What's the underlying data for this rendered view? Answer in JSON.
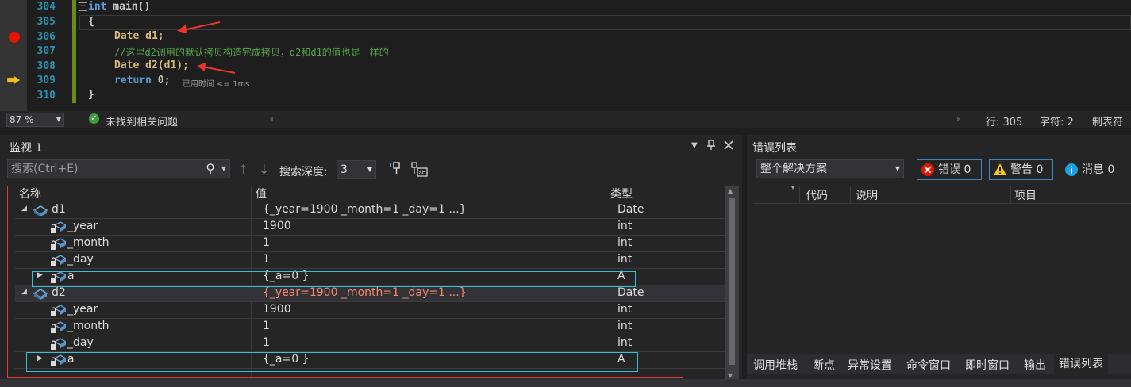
{
  "editor": {
    "lines": [
      {
        "num": "304"
      },
      {
        "num": "305"
      },
      {
        "num": "306"
      },
      {
        "num": "307"
      },
      {
        "num": "308"
      },
      {
        "num": "309"
      },
      {
        "num": "310"
      }
    ],
    "code_304_kw": "int",
    "code_304_rest": " main()",
    "code_305": "{",
    "code_306_type": "Date",
    "code_306_rest": " d1;",
    "code_307": "//这里d2调用的默认拷贝构造完成拷贝，d2和d1的值也是一样的",
    "code_308_type": "Date",
    "code_308_rest": " d2(d1);",
    "code_309_kw": "return",
    "code_309_num": " 0",
    "code_309_semi": ";",
    "code_310": "}",
    "elapsed": "已用时间 <= 1ms",
    "collapse_symbol": "−"
  },
  "status": {
    "zoom": "87 %",
    "issues": "未找到相关问题",
    "line": "行: 305",
    "char": "字符: 2",
    "tab": "制表符"
  },
  "watch": {
    "title": "监视 1",
    "search_placeholder": "搜索(Ctrl+E)",
    "depth_label": "搜索深度:",
    "depth_value": "3",
    "columns": {
      "name": "名称",
      "value": "值",
      "type": "类型"
    },
    "rows": [
      {
        "name": "d1",
        "value": "{_year=1900 _month=1 _day=1 ...}",
        "type": "Date"
      },
      {
        "name": "_year",
        "value": "1900",
        "type": "int"
      },
      {
        "name": "_month",
        "value": "1",
        "type": "int"
      },
      {
        "name": "_day",
        "value": "1",
        "type": "int"
      },
      {
        "name": "a",
        "value": "{_a=0 }",
        "type": "A"
      },
      {
        "name": "d2",
        "value": "{_year=1900 _month=1 _day=1 ...}",
        "type": "Date"
      },
      {
        "name": "_year",
        "value": "1900",
        "type": "int"
      },
      {
        "name": "_month",
        "value": "1",
        "type": "int"
      },
      {
        "name": "_day",
        "value": "1",
        "type": "int"
      },
      {
        "name": "a",
        "value": "{_a=0 }",
        "type": "A"
      }
    ]
  },
  "errors": {
    "title": "错误列表",
    "scope": "整个解决方案",
    "errors_btn": "错误 0",
    "warnings_btn": "警告 0",
    "messages_btn": "消息 0",
    "columns": {
      "code": "代码",
      "desc": "说明",
      "project": "项目"
    }
  },
  "tabs": [
    "调用堆栈",
    "断点",
    "异常设置",
    "命令窗口",
    "即时窗口",
    "输出",
    "错误列表"
  ],
  "colors": {
    "breakpoint": "#e51400",
    "highlight_red": "#e03c3c",
    "highlight_cyan": "#3bbfd2",
    "changed_value": "#f48771"
  }
}
